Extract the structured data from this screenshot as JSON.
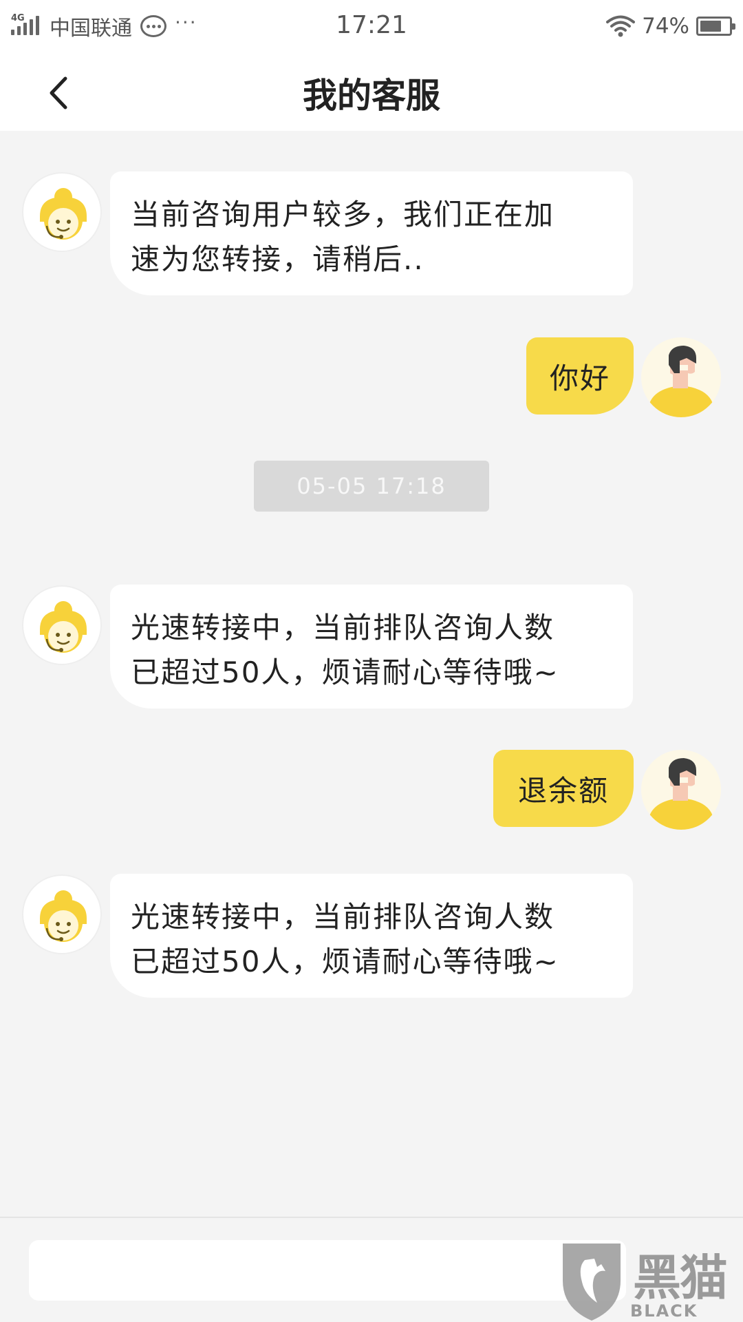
{
  "status_bar": {
    "network": "4G",
    "carrier": "中国联通",
    "more": "···",
    "time": "17:21",
    "battery": "74%",
    "battery_level": 0.74
  },
  "header": {
    "title": "我的客服",
    "back_icon": "chevron-left-icon"
  },
  "messages": [
    {
      "from": "agent",
      "text_lines": [
        "当前咨询用户较多，我们正在加",
        "速为您转接，请稍后.."
      ]
    },
    {
      "from": "user",
      "text": "你好"
    },
    {
      "type": "timestamp",
      "text": "05-05 17:18"
    },
    {
      "from": "agent",
      "text_lines": [
        "光速转接中，当前排队咨询人数",
        "已超过50人，烦请耐心等待哦~"
      ]
    },
    {
      "from": "user",
      "text": "退余额"
    },
    {
      "from": "agent",
      "text_lines": [
        "光速转接中，当前排队咨询人数",
        "已超过50人，烦请耐心等待哦~"
      ]
    }
  ],
  "input": {
    "placeholder": "",
    "value": ""
  },
  "watermark": {
    "cn": "黑猫",
    "en": "BLACK CAT"
  },
  "colors": {
    "accent_yellow": "#f7da4a",
    "background": "#f4f4f4",
    "header_bg": "#ffffff"
  }
}
